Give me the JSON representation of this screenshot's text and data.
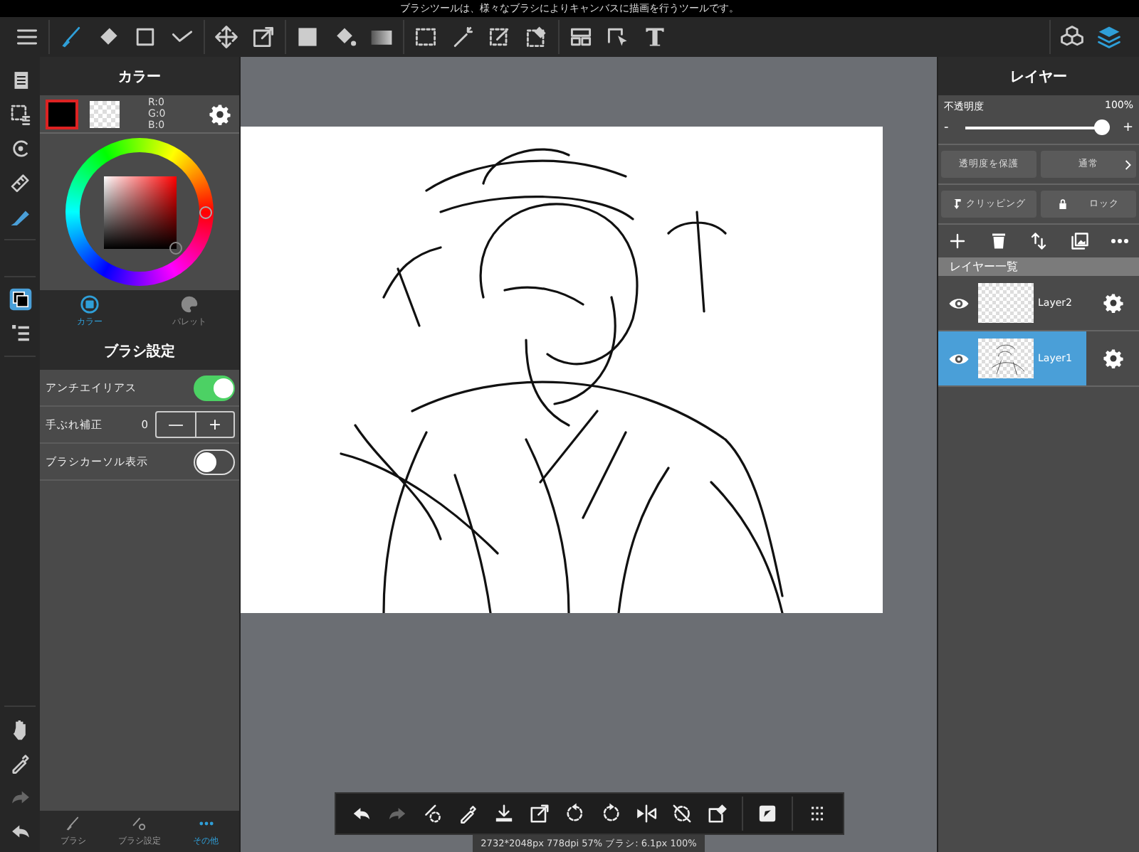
{
  "status_message": "ブラシツールは、様々なブラシによりキャンバスに描画を行うツールです。",
  "toolbar": {
    "groups": [
      [
        {
          "kind": "menu",
          "selected": false
        }
      ],
      [
        {
          "kind": "brush",
          "selected": true
        },
        {
          "kind": "eraser",
          "selected": false
        },
        {
          "kind": "rect",
          "selected": false
        },
        {
          "kind": "dots",
          "selected": false
        }
      ],
      [
        {
          "kind": "move",
          "selected": false
        },
        {
          "kind": "transform",
          "selected": false
        }
      ],
      [
        {
          "kind": "fill",
          "selected": false
        },
        {
          "kind": "bucket",
          "selected": false
        },
        {
          "kind": "gradient",
          "selected": false
        }
      ],
      [
        {
          "kind": "select",
          "selected": false
        },
        {
          "kind": "wand",
          "selected": false
        },
        {
          "kind": "selpen",
          "selected": false
        },
        {
          "kind": "seleraser",
          "selected": false
        }
      ],
      [
        {
          "kind": "divide",
          "selected": false
        },
        {
          "kind": "operation",
          "selected": false
        },
        {
          "kind": "text",
          "selected": false
        }
      ]
    ],
    "right": [
      {
        "kind": "materials",
        "selected": false
      },
      {
        "kind": "layers",
        "selected": true
      }
    ]
  },
  "left_rail": {
    "top": [
      {
        "kind": "pages",
        "selected": false
      },
      {
        "kind": "selection",
        "selected": false
      },
      {
        "kind": "rotate",
        "selected": false
      },
      {
        "kind": "ruler",
        "selected": false
      },
      {
        "kind": "pen",
        "selected": true
      }
    ],
    "middle": [
      {
        "kind": "color",
        "selected": true
      },
      {
        "kind": "list",
        "selected": false
      }
    ],
    "bottom": [
      {
        "kind": "hand",
        "selected": false,
        "disabled": false
      },
      {
        "kind": "dropper",
        "selected": false,
        "disabled": false
      },
      {
        "kind": "redo",
        "selected": false,
        "disabled": true
      },
      {
        "kind": "undo",
        "selected": false,
        "disabled": false
      }
    ]
  },
  "color_panel": {
    "title": "カラー",
    "rgb": [
      "R:0",
      "G:0",
      "B:0"
    ],
    "tabs": [
      {
        "label": "カラー",
        "kind": "color",
        "selected": true
      },
      {
        "label": "パレット",
        "kind": "palette",
        "selected": false
      }
    ]
  },
  "brush_settings": {
    "title": "ブラシ設定",
    "rows": [
      {
        "kind": "toggle",
        "label": "アンチエイリアス",
        "on": true
      },
      {
        "kind": "stepper",
        "label": "手ぶれ補正",
        "value": "0",
        "minus": "—",
        "plus": "+"
      },
      {
        "kind": "toggle",
        "label": "ブラシカーソル表示",
        "on": false
      }
    ]
  },
  "bottom_tabs": [
    {
      "label": "ブラシ",
      "kind": "brush",
      "selected": false
    },
    {
      "label": "ブラシ設定",
      "kind": "brushset",
      "selected": false
    },
    {
      "label": "その他",
      "kind": "more",
      "selected": true
    }
  ],
  "layer_panel": {
    "title": "レイヤー",
    "opacity_label": "不透明度",
    "opacity_value": "100%",
    "minus": "-",
    "plus": "+",
    "level": 1,
    "protect": "透明度を保護",
    "blend": "通常",
    "clipping": "クリッピング",
    "lock": "ロック",
    "actions": [
      {
        "kind": "add"
      },
      {
        "kind": "delete"
      },
      {
        "kind": "move"
      },
      {
        "kind": "image"
      },
      {
        "kind": "more"
      }
    ],
    "list_title": "レイヤー一覧",
    "layers": [
      {
        "name": "Layer2",
        "selected": false,
        "visible": true,
        "kind": "empty"
      },
      {
        "name": "Layer1",
        "selected": true,
        "visible": true,
        "kind": "sketch"
      }
    ]
  },
  "bottom_toolbar": [
    {
      "kind": "undo",
      "disabled": false
    },
    {
      "kind": "redo",
      "disabled": true
    },
    {
      "kind": "brushsel",
      "disabled": false
    },
    {
      "kind": "dropper",
      "disabled": false
    },
    {
      "kind": "save",
      "disabled": false
    },
    {
      "kind": "transform",
      "disabled": false
    },
    {
      "kind": "rotl",
      "disabled": false
    },
    {
      "kind": "rotr",
      "disabled": false
    },
    {
      "kind": "flip",
      "disabled": false
    },
    {
      "kind": "reset",
      "disabled": false
    },
    {
      "kind": "selerase",
      "disabled": false
    },
    {
      "kind": "fit",
      "disabled": false
    },
    {
      "kind": "grid",
      "disabled": false
    }
  ],
  "canvas_status": "2732*2048px 778dpi 57% ブラシ: 6.1px 100%"
}
